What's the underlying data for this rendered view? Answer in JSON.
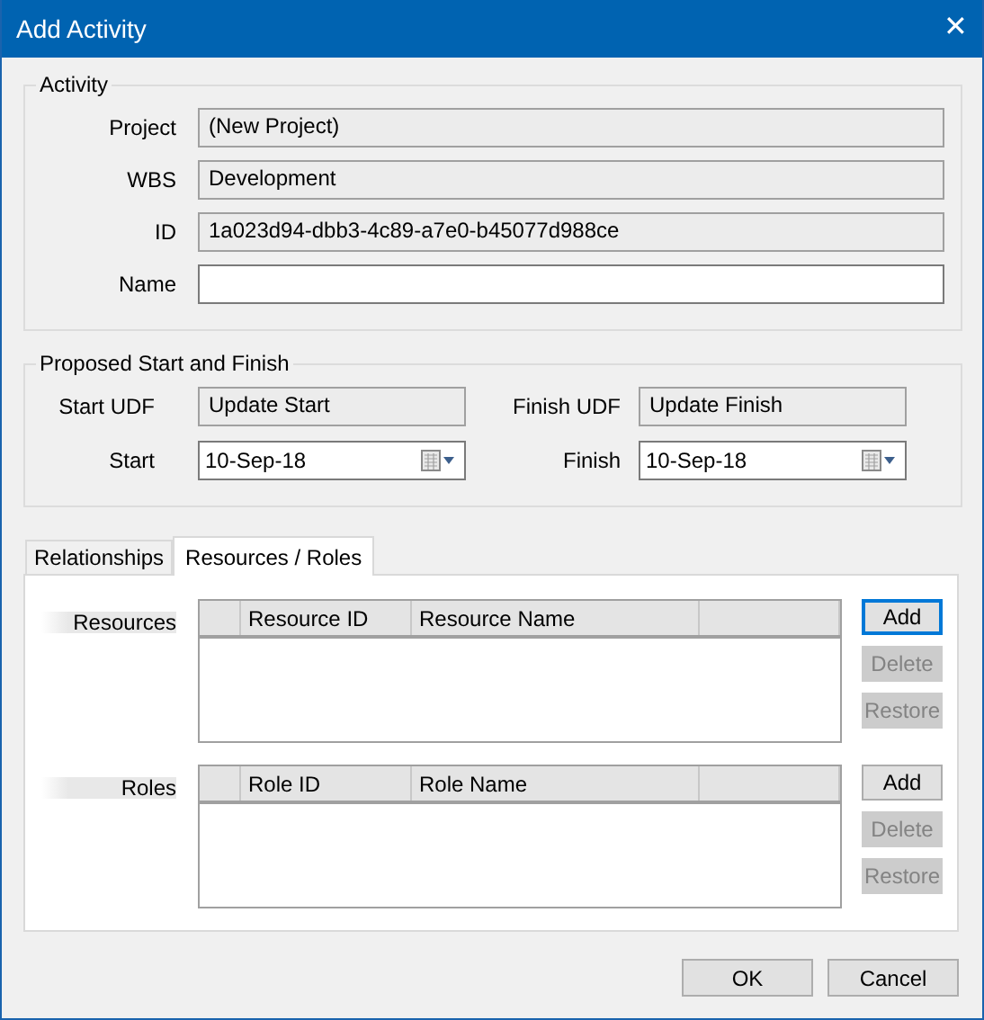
{
  "window": {
    "title": "Add Activity",
    "close": "✕"
  },
  "activity": {
    "label": "Activity",
    "fields": [
      {
        "label": "Project",
        "value": "(New Project)",
        "kind": "readonly"
      },
      {
        "label": "WBS",
        "value": "Development",
        "kind": "readonly"
      },
      {
        "label": "ID",
        "value": "1a023d94-dbb3-4c89-a7e0-b45077d988ce",
        "kind": "readonly"
      },
      {
        "label": "Name",
        "kind": "input"
      }
    ]
  },
  "proposed": {
    "label": "Proposed Start and Finish",
    "fields": [
      {
        "label": "Start UDF",
        "value": "Update Start",
        "kind": "readonly"
      },
      {
        "label": "Finish UDF",
        "value": "Update Finish",
        "kind": "readonly"
      },
      {
        "label": "Start",
        "value": "10-Sep-18",
        "kind": "date"
      },
      {
        "label": "Finish",
        "value": "10-Sep-18",
        "kind": "date"
      }
    ]
  },
  "tabs": [
    {
      "label": "Relationships",
      "selected": false
    },
    {
      "label": "Resources / Roles",
      "selected": true
    }
  ],
  "grids": [
    {
      "label": "Resources",
      "columns": [
        "Resource ID",
        "Resource Name"
      ],
      "buttons": [
        {
          "label": "Add",
          "disabled": false,
          "focused": true
        },
        {
          "label": "Delete",
          "disabled": true,
          "focused": false
        },
        {
          "label": "Restore",
          "disabled": true,
          "focused": false
        }
      ]
    },
    {
      "label": "Roles",
      "columns": [
        "Role ID",
        "Role Name"
      ],
      "buttons": [
        {
          "label": "Add",
          "disabled": false,
          "focused": false
        },
        {
          "label": "Delete",
          "disabled": true,
          "focused": false
        },
        {
          "label": "Restore",
          "disabled": true,
          "focused": false
        }
      ]
    }
  ],
  "footer_buttons": [
    "OK",
    "Cancel"
  ]
}
